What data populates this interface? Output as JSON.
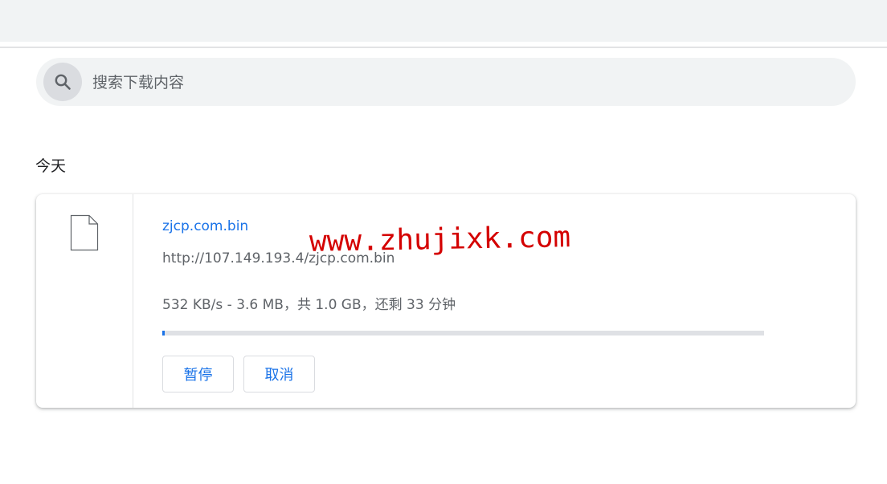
{
  "search": {
    "placeholder": "搜索下载内容",
    "icon": "search-icon"
  },
  "section": {
    "title": "今天"
  },
  "download": {
    "icon": "file-icon",
    "filename": "zjcp.com.bin",
    "url": "http://107.149.193.4/zjcp.com.bin",
    "status": "532 KB/s - 3.6 MB，共 1.0 GB，还剩 33 分钟",
    "progress_fraction": 0.0036,
    "pause_label": "暂停",
    "cancel_label": "取消"
  },
  "watermark": {
    "text": "www.zhujixk.com"
  },
  "colors": {
    "accent": "#1a73e8",
    "secondary_text": "#5f6368",
    "watermark": "#d40000"
  }
}
